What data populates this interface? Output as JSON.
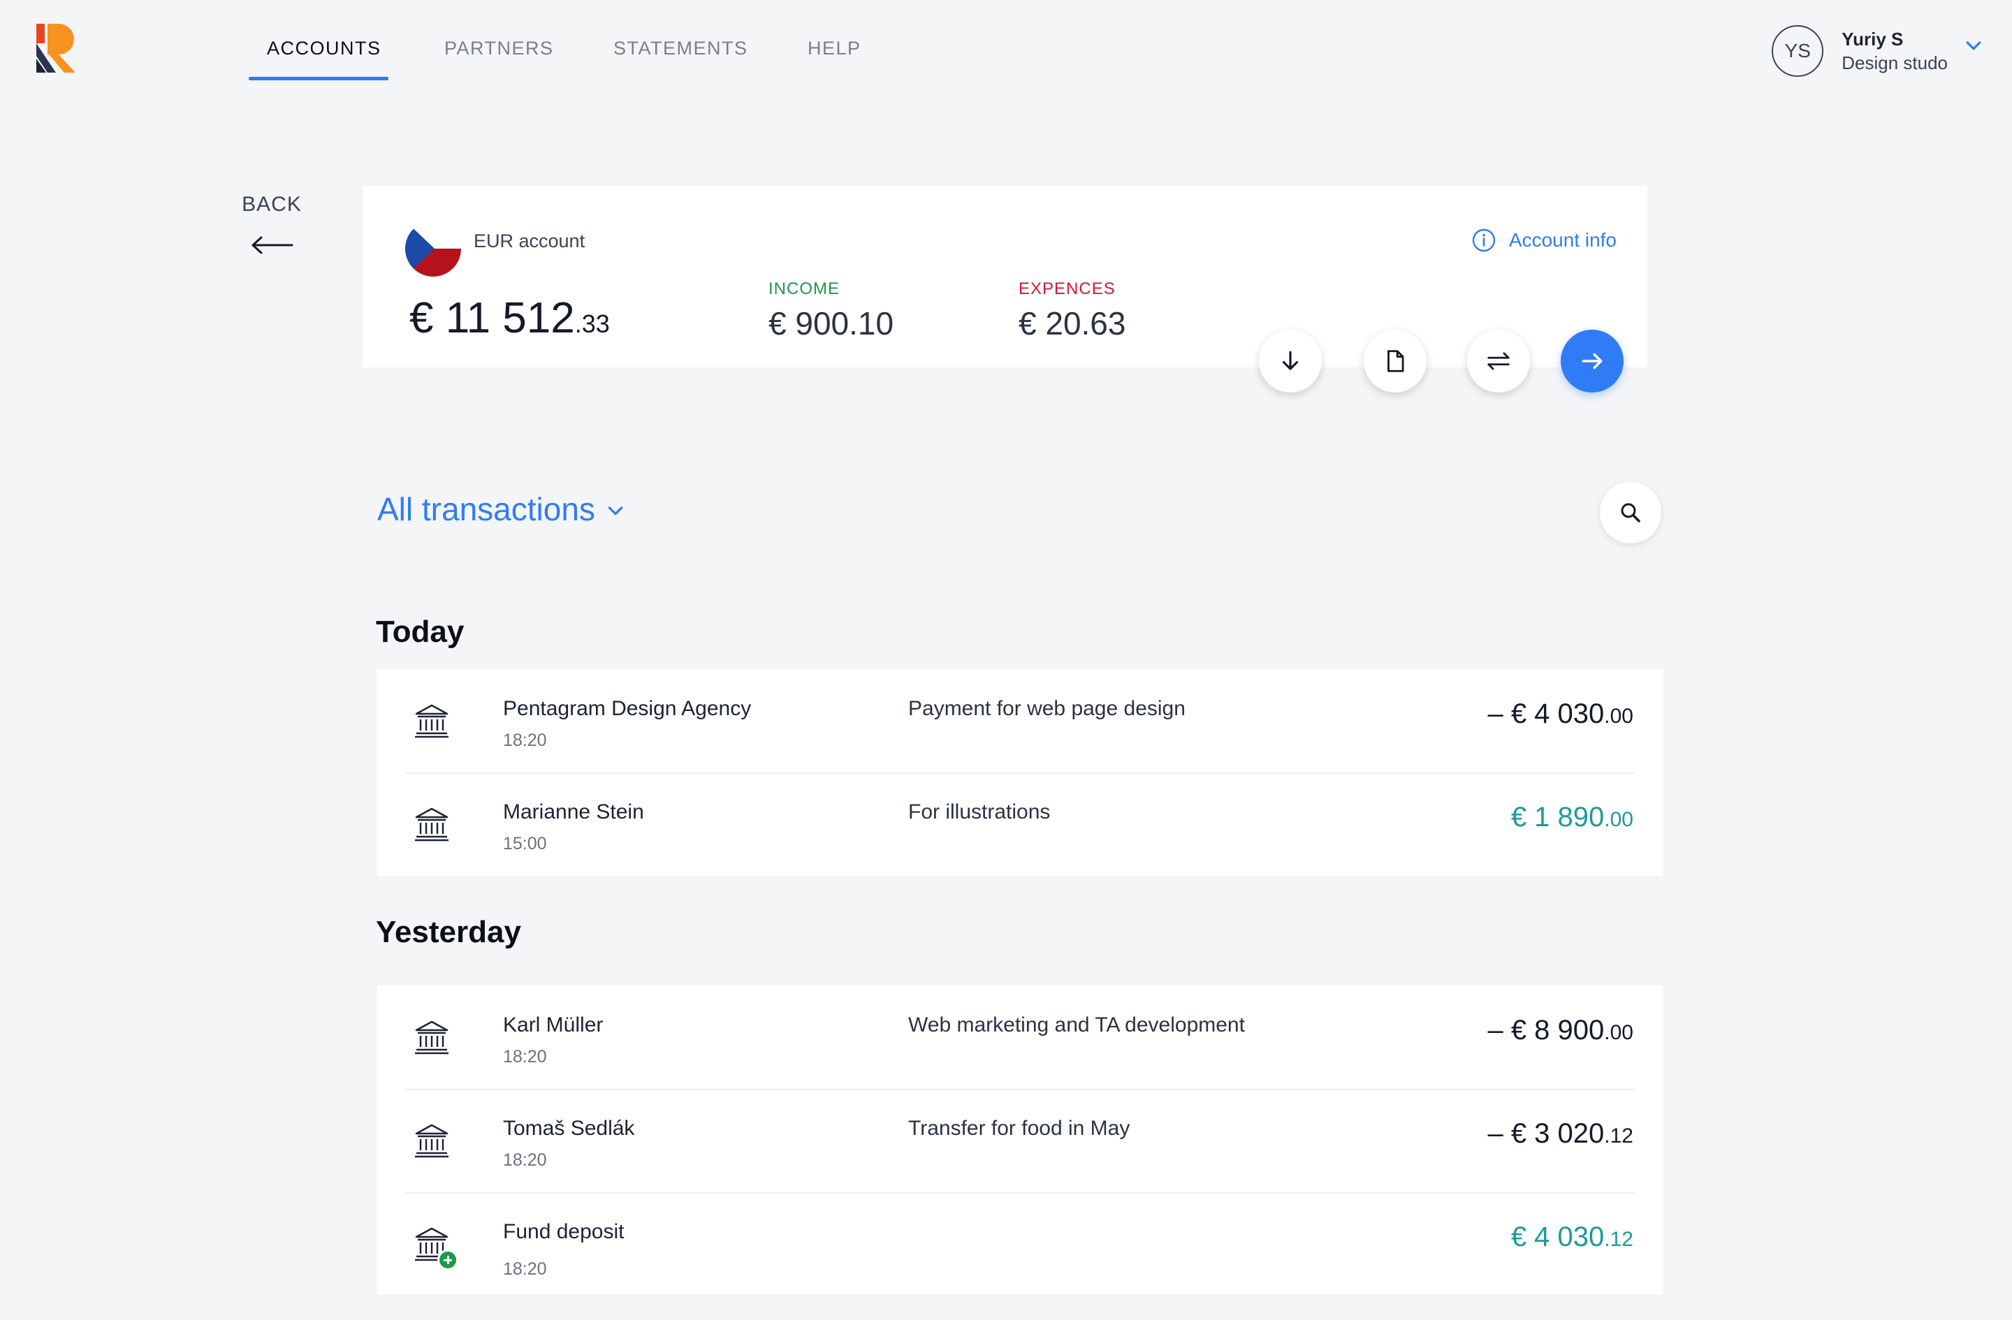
{
  "colors": {
    "accent": "#2f7cf6",
    "income": "#1a9a4a",
    "expense": "#d11a34",
    "incoming_amount": "#1e9a9a",
    "background": "#f4f5f7"
  },
  "header": {
    "nav": [
      {
        "label": "ACCOUNTS",
        "active": true
      },
      {
        "label": "PARTNERS",
        "active": false
      },
      {
        "label": "STATEMENTS",
        "active": false
      },
      {
        "label": "HELP",
        "active": false
      }
    ],
    "user": {
      "initials": "YS",
      "name": "Yuriy S",
      "org": "Design studo"
    }
  },
  "back": {
    "label": "BACK"
  },
  "account": {
    "name": "EUR account",
    "balance_main": "€ 11 512",
    "balance_cents": ".33",
    "income_label": "INCOME",
    "income_value": "€ 900.10",
    "expense_label": "EXPENCES",
    "expense_value": "€ 20.63",
    "info_link": "Account info",
    "actions": [
      "download-icon",
      "document-icon",
      "transfer-icon",
      "send-icon"
    ]
  },
  "filter": {
    "label": "All transactions"
  },
  "groups": [
    {
      "title": "Today",
      "transactions": [
        {
          "name": "Pentagram Design Agency",
          "time": "18:20",
          "description": "Payment for web page design",
          "amount_main": "– € 4 030",
          "amount_cents": ".00",
          "direction": "out",
          "icon": "bank-icon"
        },
        {
          "name": "Marianne Stein",
          "time": "15:00",
          "description": "For illustrations",
          "amount_main": "€ 1 890",
          "amount_cents": ".00",
          "direction": "in",
          "icon": "bank-icon"
        }
      ]
    },
    {
      "title": "Yesterday",
      "transactions": [
        {
          "name": "Karl Müller",
          "time": "18:20",
          "description": "Web marketing and TA development",
          "amount_main": "– € 8 900",
          "amount_cents": ".00",
          "direction": "out",
          "icon": "bank-icon"
        },
        {
          "name": "Tomaš Sedlák",
          "time": "18:20",
          "description": "Transfer for food in May",
          "amount_main": "– € 3 020",
          "amount_cents": ".12",
          "direction": "out",
          "icon": "bank-icon"
        },
        {
          "name": "Fund deposit",
          "time": "18:20",
          "description": "",
          "amount_main": "€ 4 030",
          "amount_cents": ".12",
          "direction": "in",
          "icon": "bank-deposit-icon"
        }
      ]
    }
  ]
}
